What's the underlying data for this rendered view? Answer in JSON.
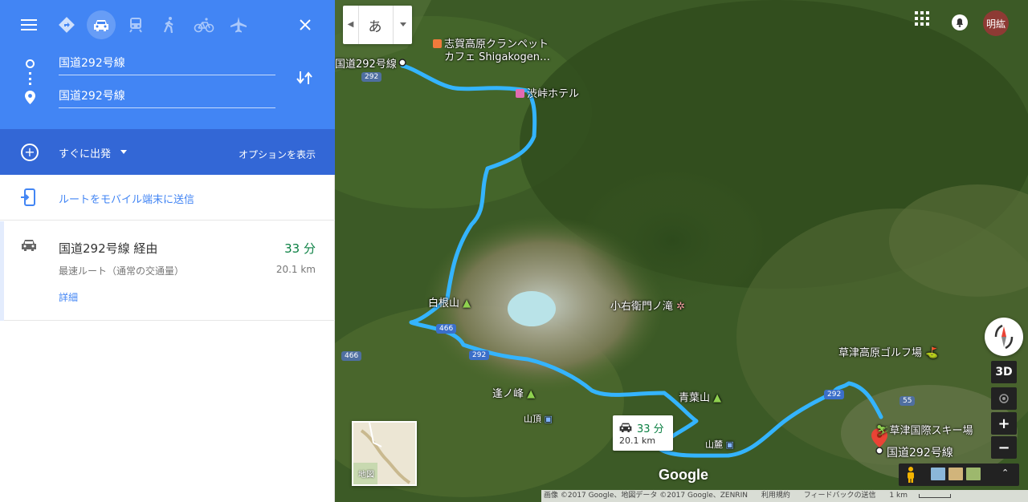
{
  "panel": {
    "origin": "国道292号線",
    "destination": "国道292号線",
    "depart_label": "すぐに出発",
    "options_label": "オプションを表示",
    "send_label": "ルートをモバイル端末に送信",
    "route": {
      "name": "国道292号線 経由",
      "time": "33 分",
      "description": "最速ルート（通常の交通量）",
      "distance": "20.1 km",
      "details_label": "詳細"
    },
    "colors": {
      "header": "#4285f4",
      "depart_bar": "#3367d6",
      "time_green": "#0b8043",
      "route_line": "#34b4ff"
    }
  },
  "map": {
    "ime_label": "あ",
    "avatar_label": "明紘",
    "labels": {
      "cafe": "志賀高原クランペット",
      "cafe_2": "カフェ Shigakogen…",
      "origin_marker": "国道292号線",
      "hotel": "渋峠ホテル",
      "shirane": "白根山",
      "koemon": "小右衛門ノ滝",
      "golf": "草津高原ゴルフ場",
      "aonomine": "逢ノ峰",
      "aobayama": "青葉山",
      "sancho": "山頂",
      "sanroku": "山麓",
      "ski": "草津国際スキー場",
      "dest_marker": "国道292号線"
    },
    "road_shields": [
      "292",
      "466",
      "466",
      "292",
      "292",
      "55"
    ],
    "bubble": {
      "time": "33 分",
      "distance": "20.1 km"
    },
    "minimap_label": "地図",
    "google_logo": "Google",
    "controls": {
      "three_d": "3D",
      "zoom_in": "+",
      "zoom_out": "−"
    },
    "footer": {
      "copyright": "画像 ©2017 Google、地図データ ©2017 Google、ZENRIN",
      "terms": "利用規約",
      "feedback": "フィードバックの送信",
      "scale": "1 km"
    }
  }
}
